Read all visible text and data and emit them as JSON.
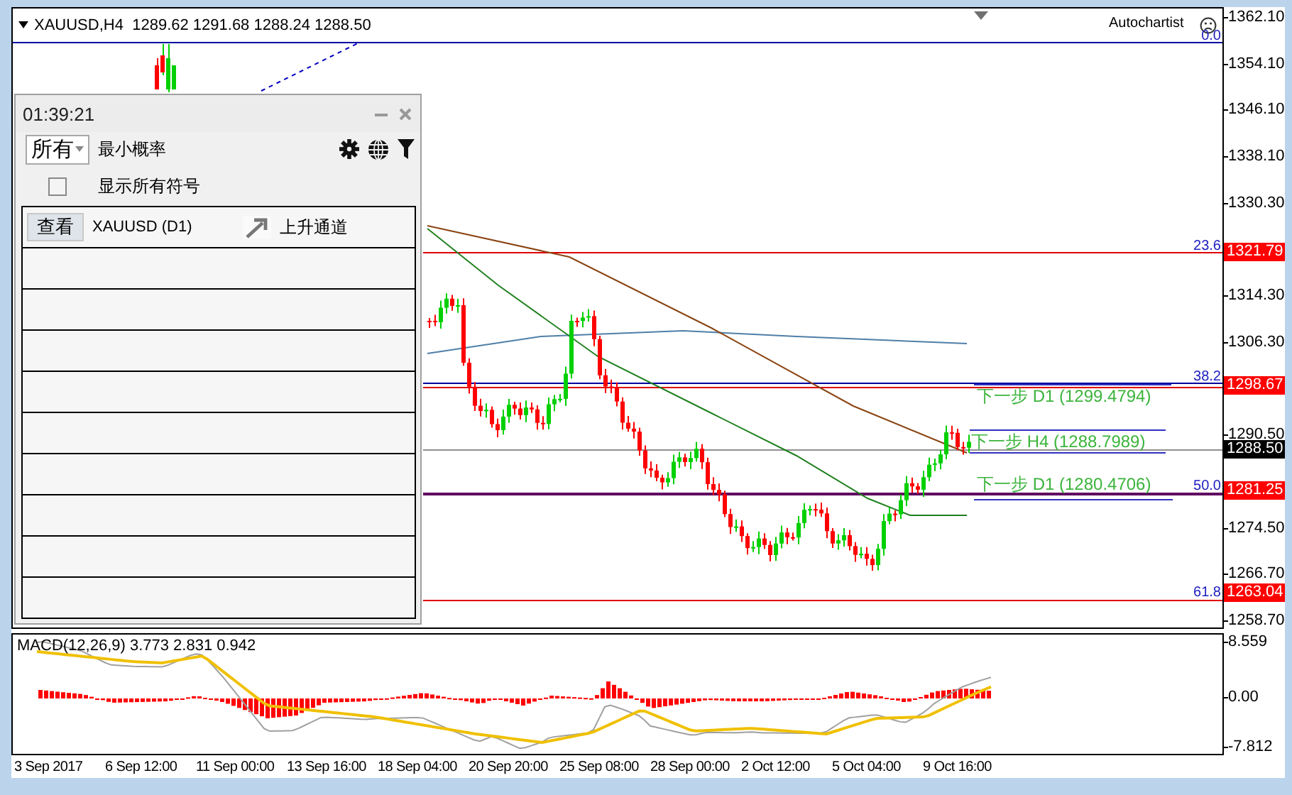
{
  "chart_header": {
    "symbol": "XAUUSD,H4",
    "ohlc": "1289.62 1291.68 1288.24 1288.50"
  },
  "autochartist": {
    "label": "Autochartist"
  },
  "fib_levels": [
    {
      "label": "0.0"
    },
    {
      "label": "23.6"
    },
    {
      "label": "38.2"
    },
    {
      "label": "50.0"
    },
    {
      "label": "61.8"
    }
  ],
  "next_steps": [
    {
      "text": "下一步 D1 (1299.4794)"
    },
    {
      "text": "下一步 H4 (1288.7989)"
    },
    {
      "text": "下一步 D1 (1280.4706)"
    }
  ],
  "price_axis": {
    "ticks": [
      "1362.10",
      "1354.10",
      "1346.10",
      "1338.10",
      "1330.30",
      "1314.30",
      "1306.30",
      "1290.50",
      "1274.50",
      "1266.70",
      "1258.70"
    ],
    "markers": [
      {
        "label": "1321.79",
        "color": "#ff0000"
      },
      {
        "label": "1298.67",
        "color": "#ff0000"
      },
      {
        "label": "1288.50",
        "color": "#000000"
      },
      {
        "label": "1281.25",
        "color": "#ff0000"
      },
      {
        "label": "1263.04",
        "color": "#ff0000"
      }
    ]
  },
  "panel": {
    "clock": "01:39:21",
    "filter": {
      "value": "所有"
    },
    "min_probability_label": "最小概率",
    "show_all": {
      "label": "显示所有符号",
      "checked": false
    },
    "results": [
      {
        "button": "查看",
        "symbol": "XAUUSD (D1)",
        "pattern": "上升通道"
      }
    ]
  },
  "macd": {
    "header": "MACD(12,26,9) 3.773 2.831 0.942",
    "ticks": [
      "8.559",
      "0.00",
      "-7.812"
    ]
  },
  "time_axis": [
    "3 Sep 2017",
    "6 Sep 12:00",
    "11 Sep 00:00",
    "13 Sep 16:00",
    "18 Sep 04:00",
    "20 Sep 20:00",
    "25 Sep 08:00",
    "28 Sep 00:00",
    "2 Oct 12:00",
    "5 Oct 04:00",
    "9 Oct 16:00"
  ]
}
